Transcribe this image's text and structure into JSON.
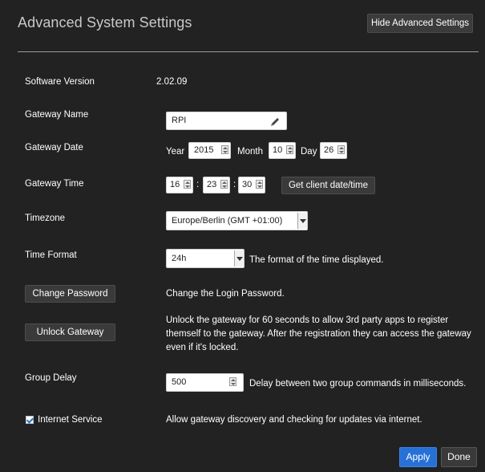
{
  "header": {
    "title": "Advanced System Settings",
    "hide_button": "Hide Advanced Settings"
  },
  "software_version": {
    "label": "Software Version",
    "value": "2.02.09"
  },
  "gateway_name": {
    "label": "Gateway Name",
    "value": "RPI"
  },
  "gateway_date": {
    "label": "Gateway Date",
    "year_label": "Year",
    "year": "2015",
    "month_label": "Month",
    "month": "10",
    "day_label": "Day",
    "day": "26"
  },
  "gateway_time": {
    "label": "Gateway Time",
    "hour": "16",
    "minute": "23",
    "second": "30",
    "separator": ":",
    "client_button": "Get client date/time"
  },
  "timezone": {
    "label": "Timezone",
    "value": "Europe/Berlin (GMT +01:00)"
  },
  "time_format": {
    "label": "Time Format",
    "value": "24h",
    "description": "The format of the time displayed."
  },
  "change_password": {
    "button": "Change Password",
    "description": "Change the Login Password."
  },
  "unlock_gateway": {
    "button": "Unlock Gateway",
    "description": "Unlock the gateway for 60 seconds to allow 3rd party apps to register themself to the gateway. After the registration they can access the gateway even if it's locked."
  },
  "group_delay": {
    "label": "Group Delay",
    "value": "500",
    "description": "Delay between two group commands in milliseconds."
  },
  "internet_service": {
    "label": "Internet Service",
    "checked": true,
    "description": "Allow gateway discovery and checking for updates via internet."
  },
  "footer": {
    "apply": "Apply",
    "done": "Done"
  },
  "colors": {
    "background": "#222222",
    "apply_button": "#2670d6",
    "text": "#ffffff",
    "title": "#c8c8c8"
  },
  "icons": {
    "edit": "pencil-icon",
    "spinner": "spinner-arrows-icon",
    "dropdown": "chevron-down-icon",
    "check": "checkmark-icon"
  }
}
